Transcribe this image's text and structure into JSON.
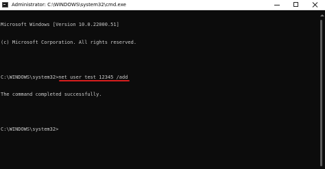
{
  "window": {
    "title": "Administrator: C:\\WINDOWS\\system32\\cmd.exe",
    "icon": "cmd-icon",
    "controls": [
      "minimize-icon",
      "maximize-icon",
      "close-icon"
    ]
  },
  "console": {
    "lines": [
      "Microsoft Windows [Version 10.0.22000.51]",
      "(c) Microsoft Corporation. All rights reserved.",
      "",
      "",
      "The command completed successfully.",
      "",
      "C:\\WINDOWS\\system32>"
    ],
    "prompt": "C:\\WINDOWS\\system32>",
    "command": "net user test 12345 /add",
    "highlight_color": "#d81e1e",
    "text_color": "#cccccc",
    "background_color": "#0c0c0c"
  }
}
